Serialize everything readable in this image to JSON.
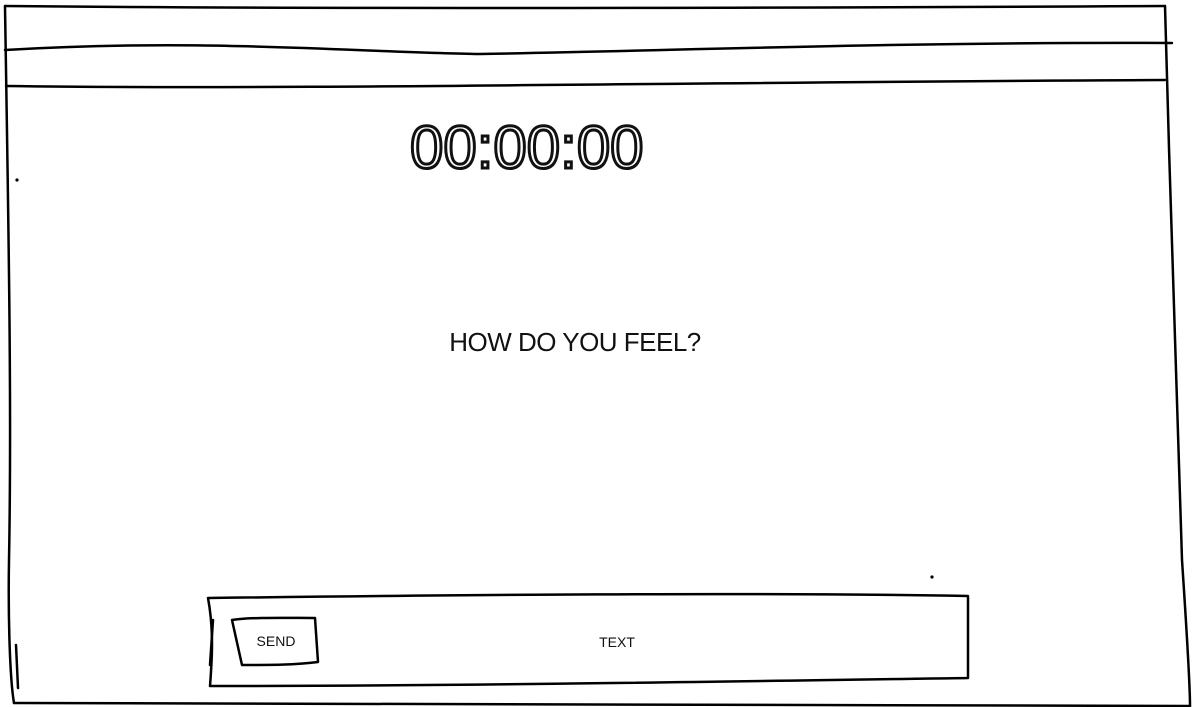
{
  "timer": {
    "display": "00:00:00"
  },
  "prompt": {
    "question": "HOW DO YOU FEEL?"
  },
  "composer": {
    "send_label": "SEND",
    "input_placeholder": "TEXT"
  }
}
